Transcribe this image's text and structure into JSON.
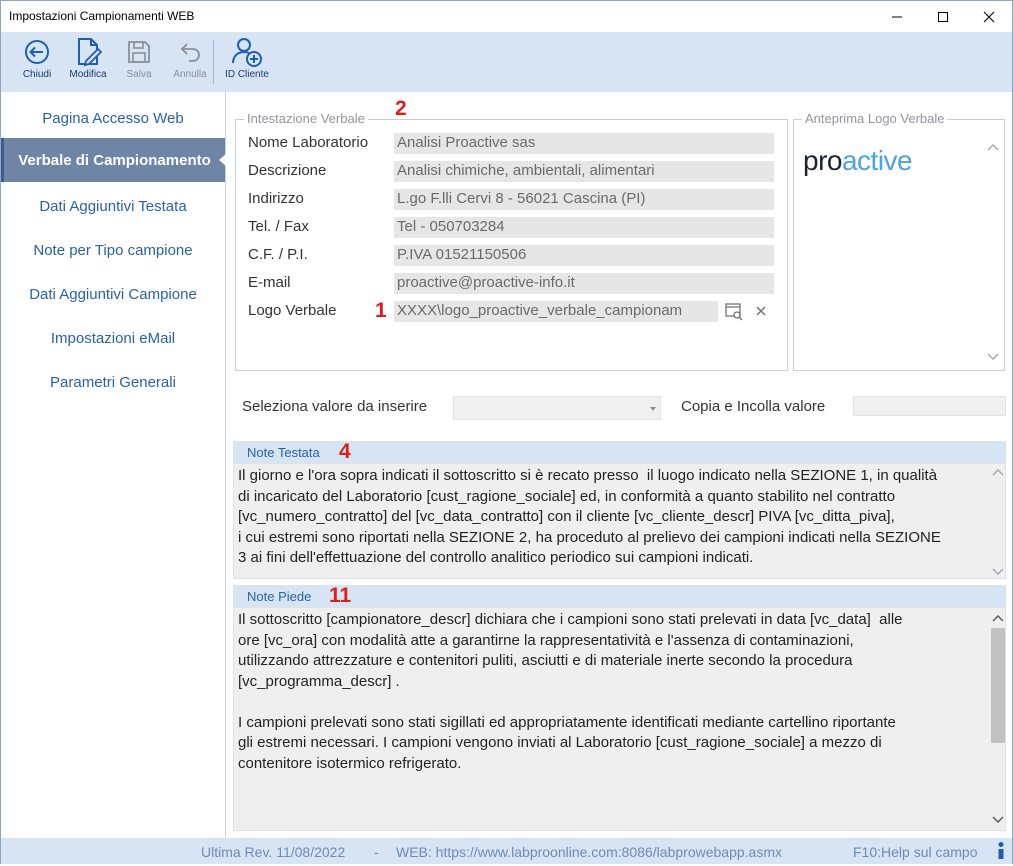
{
  "window": {
    "title": "Impostazioni Campionamenti WEB"
  },
  "toolbar": {
    "buttons": [
      {
        "label": "Chiudi",
        "icon": "arrow-left-circle-icon",
        "enabled": true
      },
      {
        "label": "Modifica",
        "icon": "edit-document-icon",
        "enabled": true
      },
      {
        "label": "Salva",
        "icon": "save-disk-icon",
        "enabled": false
      },
      {
        "label": "Annulla",
        "icon": "undo-arrow-icon",
        "enabled": false
      },
      {
        "label": "ID Cliente",
        "icon": "add-user-icon",
        "enabled": true
      }
    ]
  },
  "sidebar": {
    "items": [
      {
        "label": "Pagina Accesso Web",
        "active": false
      },
      {
        "label": "Verbale di Campionamento",
        "active": true
      },
      {
        "label": "Dati Aggiuntivi Testata",
        "active": false
      },
      {
        "label": "Note per Tipo campione",
        "active": false
      },
      {
        "label": "Dati Aggiuntivi Campione",
        "active": false
      },
      {
        "label": "Impostazioni eMail",
        "active": false
      },
      {
        "label": "Parametri Generali",
        "active": false
      }
    ]
  },
  "intestazione": {
    "title": "Intestazione Verbale",
    "badge": "2",
    "fields": [
      {
        "label": "Nome Laboratorio",
        "value": "Analisi Proactive sas"
      },
      {
        "label": "Descrizione",
        "value": "Analisi chimiche, ambientali, alimentari"
      },
      {
        "label": "Indirizzo",
        "value": " L.go F.lli Cervi 8 - 56021 Cascina (PI)"
      },
      {
        "label": "Tel. / Fax",
        "value": "Tel - 050703284"
      },
      {
        "label": "C.F. / P.I.",
        "value": "P.IVA 01521150506"
      },
      {
        "label": "E-mail",
        "value": "proactive@proactive-info.it"
      }
    ],
    "logo_label": "Logo Verbale",
    "logo_badge": "1",
    "logo_path": "XXXX\\logo_proactive_verbale_campionam"
  },
  "anteprima": {
    "title": "Anteprima Logo Verbale",
    "logo_text_dark": "pro",
    "logo_text_light": "active"
  },
  "inserimento": {
    "select_label": "Seleziona valore da inserire",
    "select_value": "",
    "copy_label": "Copia e Incolla valore",
    "copy_value": ""
  },
  "note_testata": {
    "title": "Note Testata",
    "badge": "4",
    "text": "Il giorno e l'ora sopra indicati il sottoscritto si è recato presso  il luogo indicato nella SEZIONE 1, in qualità\ndi incaricato del Laboratorio [cust_ragione_sociale] ed, in conformità a quanto stabilito nel contratto\n[vc_numero_contratto] del [vc_data_contratto] con il cliente [vc_cliente_descr] PIVA [vc_ditta_piva],\ni cui estremi sono riportati nella SEZIONE 2, ha proceduto al prelievo dei campioni indicati nella SEZIONE\n3 ai fini dell'effettuazione del controllo analitico periodico sui campioni indicati."
  },
  "note_piede": {
    "title": "Note Piede",
    "badge": "11",
    "text": "Il sottoscritto [campionatore_descr] dichiara che i campioni sono stati prelevati in data [vc_data]  alle\nore [vc_ora] con modalità atte a garantirne la rappresentatività e l'assenza di contaminazioni,\nutilizzando attrezzature e contenitori puliti, asciutti e di materiale inerte secondo la procedura\n[vc_programma_descr] .\n\nI campioni prelevati sono stati sigillati ed appropriatamente identificati mediante cartellino riportante\ngli estremi necessari. I campioni vengono inviati al Laboratorio [cust_ragione_sociale] a mezzo di\ncontenitore isotermico refrigerato."
  },
  "status": {
    "revision": "Ultima Rev. 11/08/2022",
    "separator": "-",
    "web": "WEB: https://www.labproonline.com:8086/labprowebapp.asmx",
    "help": "F10:Help sul campo"
  },
  "colors": {
    "accent": "#2a62a6",
    "toolbar_bg": "#d6e4f4",
    "active_item": "#6e85a6",
    "badge_red": "#e21b1b",
    "field_bg": "#e6e6e6"
  }
}
